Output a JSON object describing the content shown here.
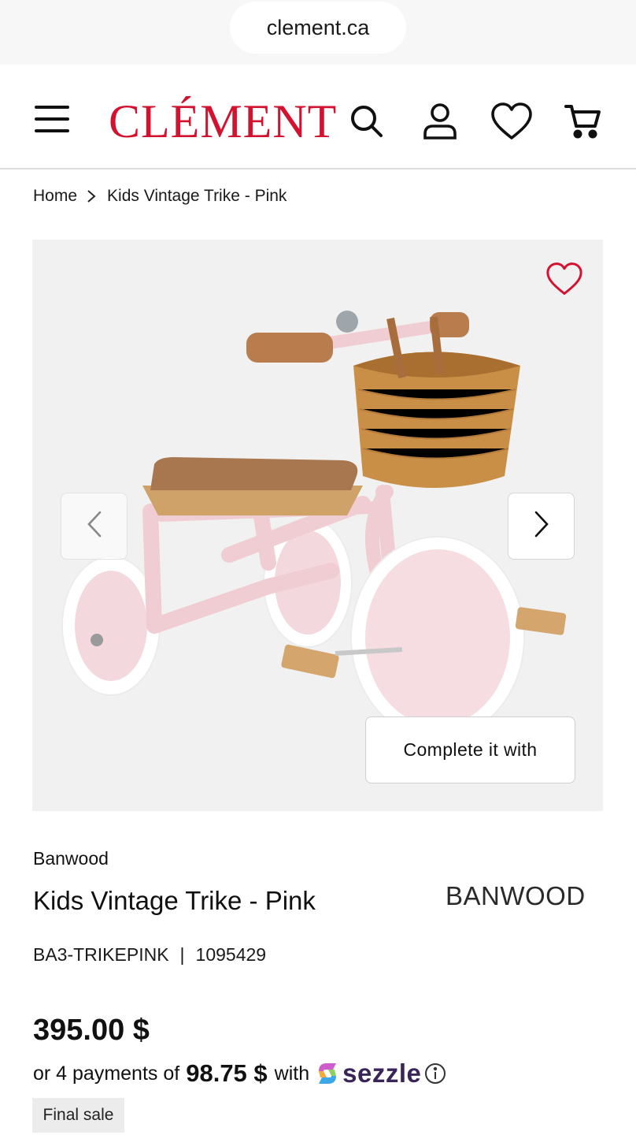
{
  "browser": {
    "url": "clement.ca"
  },
  "header": {
    "logo": "CLÉMENT",
    "menu_icon": "hamburger-menu-icon",
    "search_icon": "search-icon",
    "account_icon": "user-icon",
    "wishlist_icon": "heart-icon",
    "cart_icon": "cart-icon",
    "brand_color": "#d2122e"
  },
  "breadcrumb": {
    "home": "Home",
    "separator_icon": "chevron-right-icon",
    "current": "Kids Vintage Trike - Pink"
  },
  "gallery": {
    "image_alt": "Pink Banwood tricycle with wicker basket",
    "favorite_icon": "heart-outline-icon",
    "prev_icon": "chevron-left-icon",
    "next_icon": "chevron-right-icon",
    "complete_label": "Complete it with"
  },
  "product": {
    "brand": "Banwood",
    "title": "Kids Vintage Trike - Pink",
    "brand_logo": "BANWOOD",
    "sku": "BA3-TRIKEPINK",
    "separator": "|",
    "item_number": "1095429",
    "price": "395.00 $",
    "installments": {
      "prefix": "or 4 payments of",
      "amount": "98.75 $",
      "with": "with",
      "provider": "sezzle",
      "info_icon": "info-icon"
    },
    "badge": "Final sale"
  }
}
